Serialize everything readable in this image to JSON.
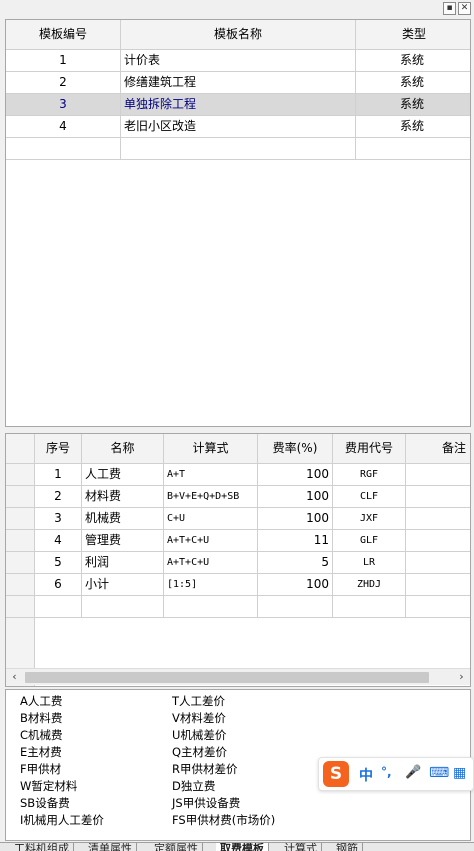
{
  "window": {
    "pin_glyph": "▪",
    "close_glyph": "✕"
  },
  "template_table": {
    "headers": [
      "模板编号",
      "模板名称",
      "类型"
    ],
    "rows": [
      {
        "id": "1",
        "name": "计价表",
        "type": "系统"
      },
      {
        "id": "2",
        "name": "修缮建筑工程",
        "type": "系统"
      },
      {
        "id": "3",
        "name": "单独拆除工程",
        "type": "系统"
      },
      {
        "id": "4",
        "name": "老旧小区改造",
        "type": "系统"
      }
    ],
    "selected_row": 3
  },
  "fee_table": {
    "headers": [
      "序号",
      "名称",
      "计算式",
      "费率(%)",
      "费用代号",
      "备注"
    ],
    "rows": [
      {
        "no": "1",
        "name": "人工费",
        "formula": "A+T",
        "rate": "100",
        "code": "RGF"
      },
      {
        "no": "2",
        "name": "材料费",
        "formula": "B+V+E+Q+D+SB",
        "rate": "100",
        "code": "CLF"
      },
      {
        "no": "3",
        "name": "机械费",
        "formula": "C+U",
        "rate": "100",
        "code": "JXF"
      },
      {
        "no": "4",
        "name": "管理费",
        "formula": "A+T+C+U",
        "rate": "11",
        "code": "GLF"
      },
      {
        "no": "5",
        "name": "利润",
        "formula": "A+T+C+U",
        "rate": "5",
        "code": "LR"
      },
      {
        "no": "6",
        "name": "小计",
        "formula": "[1:5]",
        "rate": "100",
        "code": "ZHDJ"
      }
    ]
  },
  "scrollbar": {
    "left": "‹",
    "right": "›"
  },
  "legend": {
    "left": [
      "A人工费",
      "B材料费",
      "C机械费",
      "E主材费",
      "F甲供材",
      "W暂定材料",
      "SB设备费",
      "I机械用人工差价"
    ],
    "right": [
      "T人工差价",
      "V材料差价",
      "U机械差价",
      "Q主材差价",
      "R甲供材差价",
      "D独立费",
      "JS甲供设备费",
      "FS甲供材费(市场价)"
    ]
  },
  "ime": {
    "logo": "S",
    "lang": "中",
    "punct": "°,",
    "mic": "🎤",
    "keyboard": "⌨",
    "apps": "▦",
    "brand_color": "#f5641e",
    "icon_color": "#1a6fe0"
  },
  "tabs": [
    "工料机组成",
    "清单属性",
    "定额属性",
    "取费模板",
    "计算式",
    "钢筋"
  ],
  "active_tab": "取费模板"
}
